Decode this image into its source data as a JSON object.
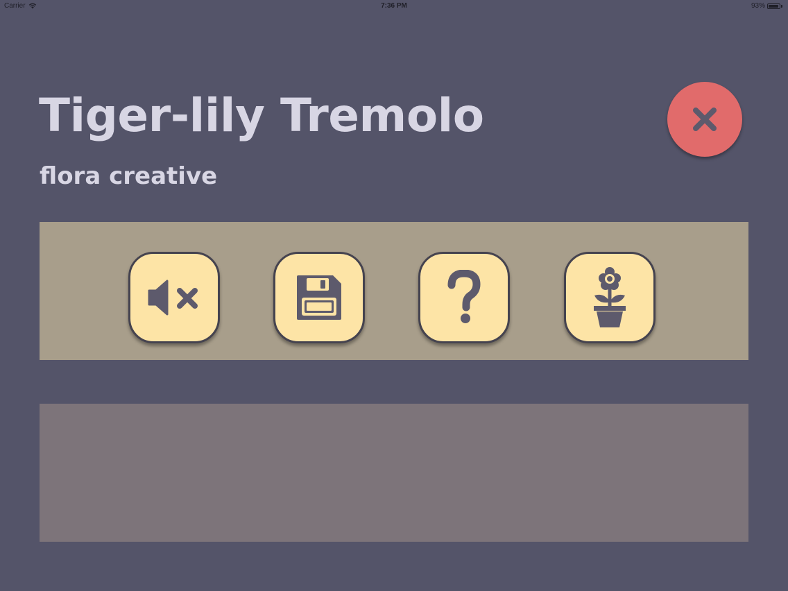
{
  "status_bar": {
    "carrier": "Carrier",
    "time": "7:36 PM",
    "battery": "93%",
    "battery_level": 0.93
  },
  "header": {
    "title": "Tiger-lily Tremolo",
    "subtitle": "flora creative"
  },
  "close_button": {
    "icon": "close-icon"
  },
  "toolbar": {
    "buttons": [
      {
        "icon": "mute-icon"
      },
      {
        "icon": "save-icon"
      },
      {
        "icon": "help-icon"
      },
      {
        "icon": "flower-pot-icon"
      }
    ]
  },
  "colors": {
    "background": "#545469",
    "title": "#d8d6e4",
    "close_button": "#e16b6b",
    "toolbar_panel": "#a89e8b",
    "tool_button": "#fde4a6",
    "icon": "#5d5a6c",
    "content_panel": "#7d747a"
  }
}
